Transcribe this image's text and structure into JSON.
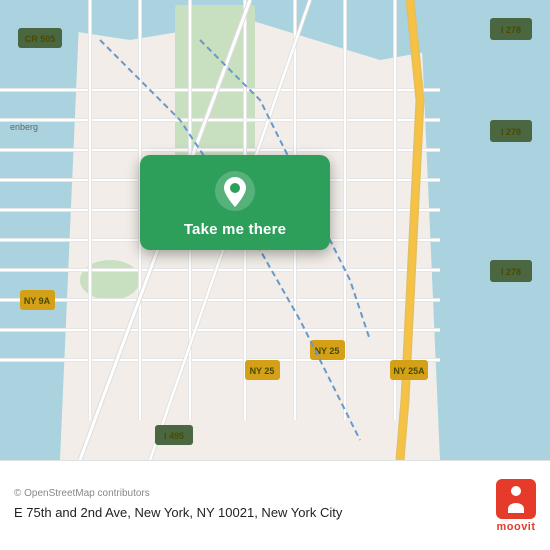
{
  "map": {
    "alt": "Map of E 75th and 2nd Ave, New York, NY 10021",
    "copyright": "© OpenStreetMap contributors",
    "take_me_there_label": "Take me there"
  },
  "bottom_bar": {
    "address": "E 75th and 2nd Ave, New York, NY 10021, New York City",
    "moovit_label": "moovit"
  },
  "icons": {
    "location_pin": "location-pin-icon",
    "moovit_logo": "moovit-logo-icon"
  }
}
